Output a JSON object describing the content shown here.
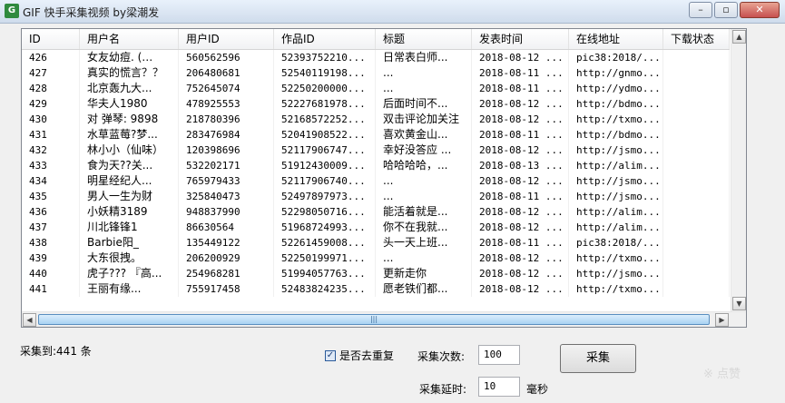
{
  "window": {
    "title": "GIF 快手采集视频 by梁潮发",
    "app_icon": "app-icon",
    "minimize": "–",
    "maximize": "▫",
    "close": "✕"
  },
  "table": {
    "columns": [
      "ID",
      "用户名",
      "用户ID",
      "作品ID",
      "标题",
      "发表时间",
      "在线地址",
      "下载状态"
    ],
    "rows": [
      [
        "426",
        "女友幼痘. (…",
        "560562596",
        "52393752210...",
        "日常表白师...",
        "2018-08-12 ...",
        "pic38:2018/...",
        ""
      ],
      [
        "427",
        "真实的慌言？？",
        "206480681",
        "52540119198...",
        "...",
        "2018-08-11 ...",
        "http://gnmo...",
        ""
      ],
      [
        "428",
        "北京轰九大...",
        "752645074",
        "52250200000...",
        "...",
        "2018-08-11 ...",
        "http://ydmo...",
        ""
      ],
      [
        "429",
        "华夫人1980",
        "478925553",
        "52227681978...",
        "后面时间不...",
        "2018-08-12 ...",
        "http://bdmo...",
        ""
      ],
      [
        "430",
        "对  弹琴: 9898",
        "218780396",
        "52168572252...",
        "双击评论加关注",
        "2018-08-12 ...",
        "http://txmo...",
        ""
      ],
      [
        "431",
        "水草蓝莓?梦...",
        "283476984",
        "52041908522...",
        "喜欢黄金山...",
        "2018-08-11 ...",
        "http://bdmo...",
        ""
      ],
      [
        "432",
        "林小小（仙味）",
        "120398696",
        "52117906747...",
        "幸好没答应 ...",
        "2018-08-12 ...",
        "http://jsmo...",
        ""
      ],
      [
        "433",
        "食为天??关...",
        "532202171",
        "51912430009...",
        "哈哈哈哈，...",
        "2018-08-13 ...",
        "http://alim...",
        ""
      ],
      [
        "434",
        "明星经纪人...",
        "765979433",
        "52117906740...",
        "...",
        "2018-08-12 ...",
        "http://jsmo...",
        ""
      ],
      [
        "435",
        "男人一生为财",
        "325840473",
        "52497897973...",
        "...",
        "2018-08-11 ...",
        "http://jsmo...",
        ""
      ],
      [
        "436",
        "小妖精3189",
        "948837990",
        "52298050716...",
        "能活着就是...",
        "2018-08-12 ...",
        "http://alim...",
        ""
      ],
      [
        "437",
        "川北锋锋1",
        "86630564",
        "51968724993...",
        "你不在我就...",
        "2018-08-12 ...",
        "http://alim...",
        ""
      ],
      [
        "438",
        "Barbie阳_",
        "135449122",
        "52261459008...",
        "头一天上班...",
        "2018-08-11 ...",
        "pic38:2018/...",
        ""
      ],
      [
        "439",
        "大东很拽。",
        "206200929",
        "52250199971...",
        "...",
        "2018-08-12 ...",
        "http://txmo...",
        ""
      ],
      [
        "440",
        "虎子??? 『高...",
        "254968281",
        "51994057763...",
        "更新走你",
        "2018-08-12 ...",
        "http://jsmo...",
        ""
      ],
      [
        "441",
        "    王丽有缘...",
        "755917458",
        "52483824235...",
        "愿老铁们都...",
        "2018-08-12 ...",
        "http://txmo...",
        ""
      ]
    ]
  },
  "scroll": {
    "up": "▲",
    "down": "▼",
    "left": "◀",
    "right": "▶",
    "grip": "|||"
  },
  "status": {
    "collected_text": "采集到:441 条"
  },
  "options": {
    "dedupe_label": "是否去重复",
    "dedupe_checked": true,
    "count_label": "采集次数:",
    "count_value": "100",
    "delay_label": "采集延时:",
    "delay_value": "10",
    "delay_unit": "毫秒",
    "collect_button": "采集"
  },
  "watermark": "※ 点赞"
}
